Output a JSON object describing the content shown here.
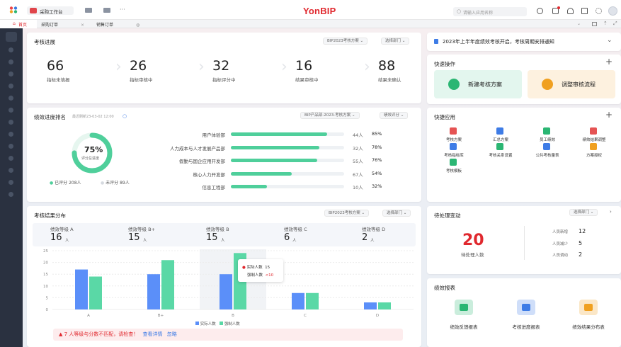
{
  "topbar": {
    "app_name": "采购工作台",
    "brand": "YonBIP",
    "search_placeholder": "请输入应用名称",
    "more": "···"
  },
  "tabs": [
    {
      "label": "首页"
    },
    {
      "label": "采购订单"
    },
    {
      "label": "销售订单"
    }
  ],
  "progress": {
    "title": "考核进展",
    "plan": "BIP2023考核方案",
    "dept": "选择部门",
    "stats": [
      {
        "value": "66",
        "label": "指标未填报"
      },
      {
        "value": "26",
        "label": "指标审核中"
      },
      {
        "value": "32",
        "label": "指标评分中"
      },
      {
        "value": "16",
        "label": "结果审核中"
      },
      {
        "value": "88",
        "label": "结果未确认"
      }
    ]
  },
  "ranking": {
    "title": "绩效进度排名",
    "updated": "最近刷新23-03-02 12:00",
    "plan": "BIP产品部-2023-考核方案",
    "dim": "绩效评分",
    "ring_value": "75%",
    "ring_fraction": 0.75,
    "ring_label": "评分总进度",
    "legend_scored": "已评分",
    "scored_count": "208人",
    "legend_unscored": "未评分",
    "unscored_count": "89人",
    "rows": [
      {
        "dept": "用户体验部",
        "count": "44人",
        "pct": "85%",
        "frac": 0.85
      },
      {
        "dept": "人力成本与人才发展产品部",
        "count": "32人",
        "pct": "78%",
        "frac": 0.78
      },
      {
        "dept": "假勤与国企应用开发部",
        "count": "55人",
        "pct": "76%",
        "frac": 0.76
      },
      {
        "dept": "核心人力开发部",
        "count": "67人",
        "pct": "54%",
        "frac": 0.54
      },
      {
        "dept": "信息工程部",
        "count": "10人",
        "pct": "32%",
        "frac": 0.32
      }
    ]
  },
  "distribution": {
    "title": "考核结果分布",
    "plan": "BIP2023考核方案",
    "dept": "选择部门",
    "unit": "人",
    "grades": [
      {
        "label": "绩效等级 A",
        "value": "16"
      },
      {
        "label": "绩效等级 B+",
        "value": "15"
      },
      {
        "label": "绩效等级 B",
        "value": "15"
      },
      {
        "label": "绩效等级 C",
        "value": "6"
      },
      {
        "label": "绩效等级 D",
        "value": "2"
      }
    ],
    "tooltip": {
      "actual_label": "实际人数",
      "actual_value": "15",
      "forced_label": "强制人数",
      "forced_value": "<10"
    },
    "warning": "7 人等级与分数不匹配，请检查！",
    "warning_link": "查看详情",
    "warning_ignore": "忽略"
  },
  "chart_data": {
    "type": "bar",
    "categories": [
      "A",
      "B+",
      "B",
      "C",
      "D"
    ],
    "ylim": [
      0,
      25
    ],
    "yticks": [
      "0",
      "5",
      "10",
      "15",
      "20",
      "25"
    ],
    "series": [
      {
        "name": "实际人数",
        "color": "#5b8ff9",
        "values": [
          17,
          15,
          15,
          7,
          3
        ]
      },
      {
        "name": "强制人数",
        "color": "#5ad8a6",
        "values": [
          14,
          21,
          24,
          7,
          3
        ]
      }
    ]
  },
  "notice": {
    "text": "2023年上半年度绩效考核开启，考核周期安排通知"
  },
  "quick_ops": {
    "title": "快速操作",
    "items": [
      {
        "label": "新建考核方案"
      },
      {
        "label": "调整审核流程"
      }
    ]
  },
  "quick_apps": {
    "title": "快捷应用",
    "items": [
      {
        "label": "考核方案",
        "color": "#e55353"
      },
      {
        "label": "汇总方案",
        "color": "#3e7ce6"
      },
      {
        "label": "员工绩效",
        "color": "#2bb673"
      },
      {
        "label": "绩效结果调整",
        "color": "#e55353"
      },
      {
        "label": "考核指标库",
        "color": "#3e7ce6"
      },
      {
        "label": "考核关系设置",
        "color": "#2bb673"
      },
      {
        "label": "公共考核量表",
        "color": "#3e7ce6"
      },
      {
        "label": "方案授权",
        "color": "#f0a020"
      },
      {
        "label": "考核模板",
        "color": "#2bb673"
      }
    ]
  },
  "pending": {
    "title": "待处理变动",
    "dept": "选择部门",
    "value": "20",
    "label": "待处理人数",
    "items": [
      {
        "label": "人员新增",
        "value": "12"
      },
      {
        "label": "人员减少",
        "value": "5"
      },
      {
        "label": "人员调动",
        "value": "2"
      }
    ]
  },
  "reports": {
    "title": "绩效报表",
    "items": [
      {
        "label": "绩效反馈报表",
        "color": "#2bb673"
      },
      {
        "label": "考核进度报表",
        "color": "#3e7ce6"
      },
      {
        "label": "绩效结果分布表",
        "color": "#f0a020"
      }
    ]
  }
}
